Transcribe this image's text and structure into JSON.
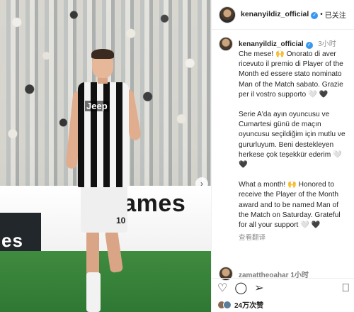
{
  "photo": {
    "board_text": "games",
    "board_dark_text": "es",
    "jersey_sponsor": "Jeep",
    "jersey_number": "10",
    "next_glyph": "›"
  },
  "header": {
    "username": "kenanyildiz_official",
    "verified_glyph": "✓",
    "separator": "•",
    "follow_status": "已关注"
  },
  "caption": {
    "username": "kenanyildiz_official",
    "time": "3小时",
    "paragraphs": [
      "Che mese! 🙌 Onorato di aver ricevuto il premio di Player of the Month ed essere stato nominato Man of the Match sabato. Grazie per il vostro supporto 🤍 🖤",
      "Serie A'da ayın oyuncusu ve Cumartesi günü de maçın oyuncusu seçildiğim için mutlu ve gururluyum. Beni destekleyen herkese çok teşekkür ederim 🤍 🖤",
      "What a month! 🙌 Honored to receive the Player of the Month award and to be named Man of the Match on Saturday. Grateful for all your support 🤍 🖤"
    ],
    "see_translation": "查看翻译"
  },
  "comment_peek": {
    "username": "zamattheoahar",
    "time": "1小时"
  },
  "actions": {
    "like_icon": "♡",
    "comment_icon": "◯",
    "share_icon": "➢",
    "save_icon": "⎕"
  },
  "likes": {
    "text": "24万次赞"
  }
}
